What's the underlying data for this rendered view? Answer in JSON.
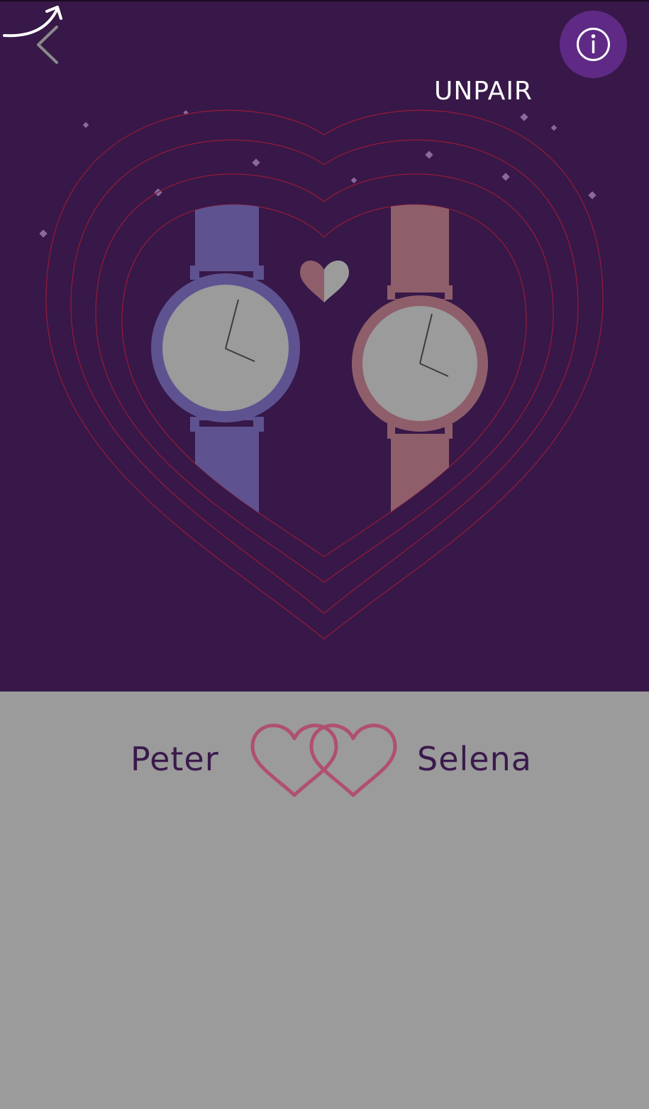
{
  "header": {
    "back_icon": "chevron-left-icon",
    "info_icon": "info-icon",
    "unpair_hint": "UNPAIR"
  },
  "illustration": {
    "description_icons": [
      "heart-rings",
      "watch-left",
      "watch-right",
      "split-heart-icon",
      "sparkles"
    ],
    "colors": {
      "background": "#371848",
      "left_watch": "#5e5390",
      "right_watch": "#8f5e6b",
      "rings": "#8b1a3a"
    }
  },
  "pair": {
    "left_name": "Peter",
    "right_name": "Selena",
    "link_icon": "linked-hearts-icon"
  },
  "colors": {
    "bottom_background": "#9b9b9b",
    "name_text": "#3a1a4c",
    "accent": "#5f2a85",
    "hearts": "#b0506e"
  }
}
